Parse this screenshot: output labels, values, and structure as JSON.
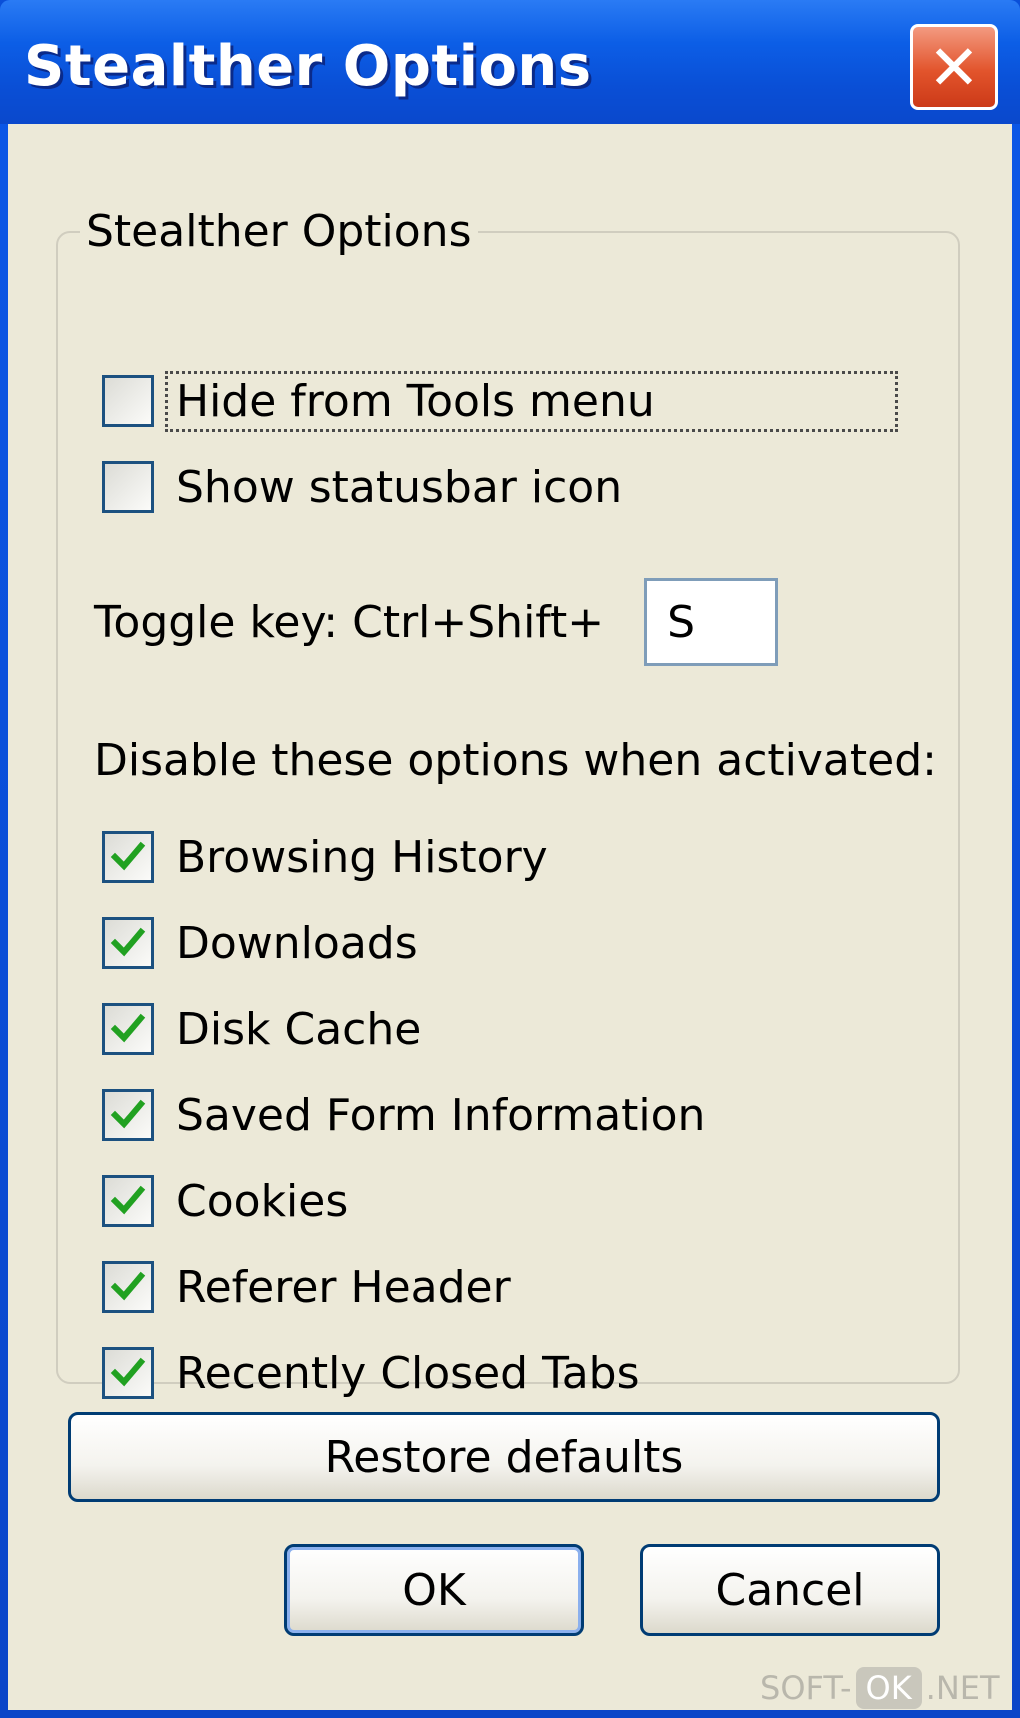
{
  "window": {
    "title": "Stealther Options",
    "close_symbol": "✕"
  },
  "group": {
    "legend": "Stealther Options",
    "hide_from_tools": {
      "label": "Hide from Tools menu",
      "checked": false
    },
    "show_statusbar": {
      "label": "Show statusbar icon",
      "checked": false
    },
    "toggle_key": {
      "label": "Toggle key: Ctrl+Shift+",
      "value": "S"
    },
    "disable_heading": "Disable these options when activated:",
    "options": [
      {
        "label": "Browsing History",
        "checked": true
      },
      {
        "label": "Downloads",
        "checked": true
      },
      {
        "label": "Disk Cache",
        "checked": true
      },
      {
        "label": "Saved Form Information",
        "checked": true
      },
      {
        "label": "Cookies",
        "checked": true
      },
      {
        "label": "Referer Header",
        "checked": true
      },
      {
        "label": "Recently Closed Tabs",
        "checked": true
      }
    ]
  },
  "buttons": {
    "restore": "Restore defaults",
    "ok": "OK",
    "cancel": "Cancel"
  },
  "watermark": {
    "prefix": "SOFT-",
    "badge": "OK",
    "suffix": ".NET"
  },
  "colors": {
    "titlebar": "#0a4fd6",
    "dialog_bg": "#ece9d8",
    "checkmark": "#21a121",
    "checkbox_border": "#1c5180",
    "close_button": "#e2542c"
  },
  "icons": {
    "close": "close-icon",
    "check": "checkmark-icon"
  }
}
